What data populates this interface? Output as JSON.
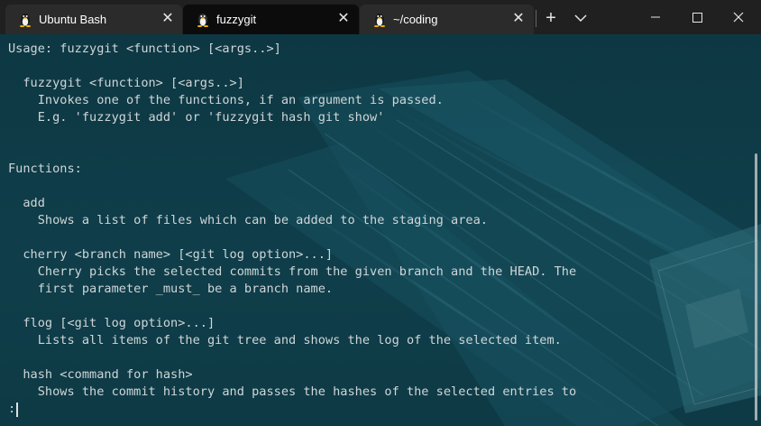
{
  "tabs": [
    {
      "label": "Ubuntu Bash",
      "icon": "tux-icon",
      "active": false
    },
    {
      "label": "fuzzygit",
      "icon": "tux-icon",
      "active": true
    },
    {
      "label": "~/coding",
      "icon": "tux-icon",
      "active": false
    }
  ],
  "toolbar": {
    "new_tab": "+",
    "dropdown_icon": "chevron-down-icon"
  },
  "window_controls": [
    "minimize-icon",
    "maximize-icon",
    "close-icon"
  ],
  "terminal": {
    "lines": [
      "Usage: fuzzygit <function> [<args..>]",
      "",
      "  fuzzygit <function> [<args..>]",
      "    Invokes one of the functions, if an argument is passed.",
      "    E.g. 'fuzzygit add' or 'fuzzygit hash git show'",
      "",
      "",
      "Functions:",
      "",
      "  add",
      "    Shows a list of files which can be added to the staging area.",
      "",
      "  cherry <branch name> [<git log option>...]",
      "    Cherry picks the selected commits from the given branch and the HEAD. The",
      "    first parameter _must_ be a branch name.",
      "",
      "  flog [<git log option>...]",
      "    Lists all items of the git tree and shows the log of the selected item.",
      "",
      "  hash <command for hash>",
      "    Shows the commit history and passes the hashes of the selected entries to"
    ],
    "prompt": ":"
  },
  "colors": {
    "titlebar": "#202020",
    "active_tab": "#0c0c0c",
    "terminal_bg": "#0e3a44",
    "text": "#cfd6d8"
  }
}
